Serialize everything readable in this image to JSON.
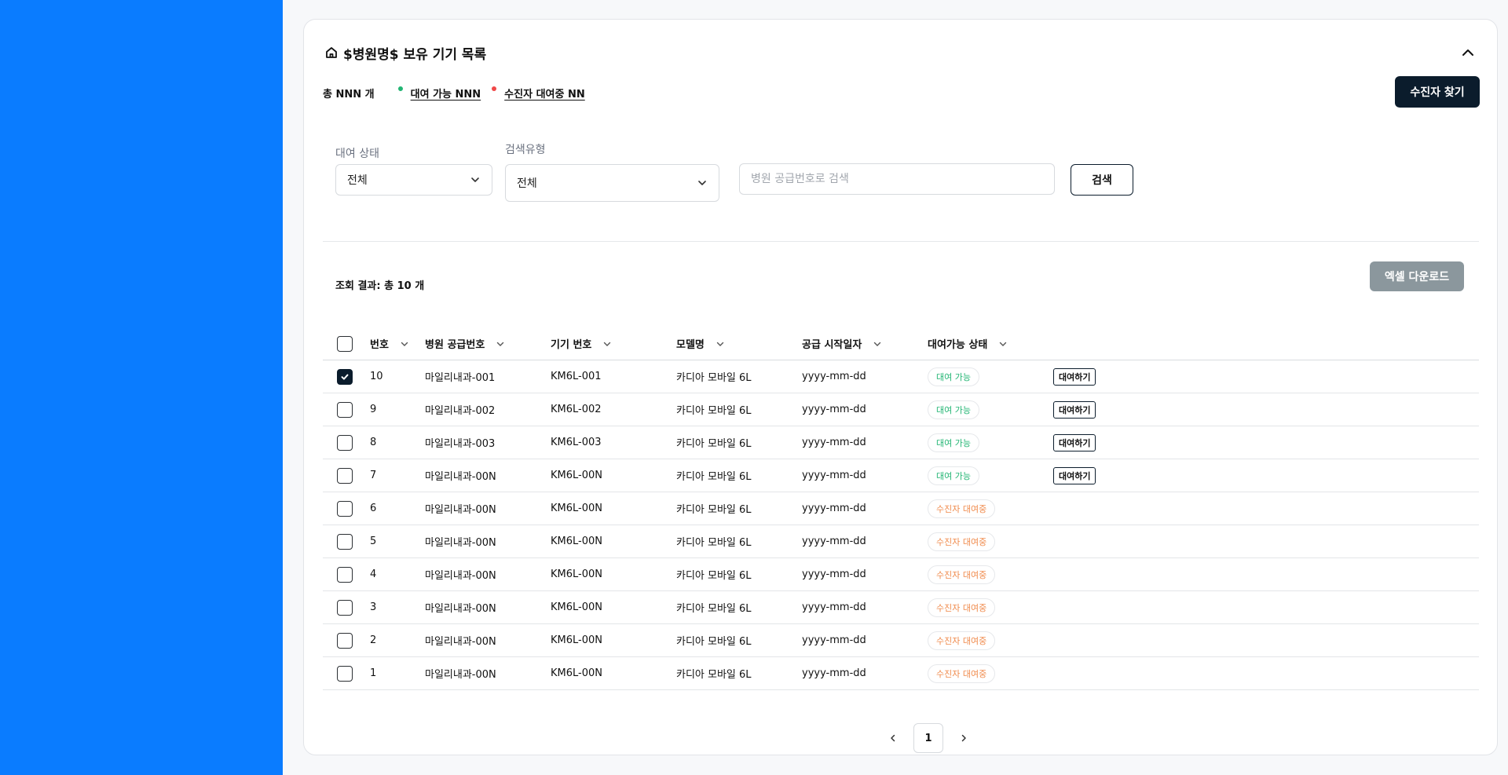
{
  "card": {
    "title": "$병원명$ 보유 기기 목록"
  },
  "summary": {
    "total": "총 NNN 개",
    "available_link": "대여 가능 NNN",
    "rented_link": "수진자 대여중 NN",
    "available_color": "#22b573",
    "rented_color": "#f04848"
  },
  "actions": {
    "find_patient": "수진자 찾기",
    "search": "검색",
    "excel": "엑셀 다운로드"
  },
  "filters": {
    "rental_status_label": "대여 상태",
    "rental_status_value": "전체",
    "search_type_label": "검색유형",
    "search_type_value": "전체",
    "search_placeholder": "병원 공급번호로 검색",
    "search_value": ""
  },
  "results": {
    "count_text": "조회 결과: 총 10 개"
  },
  "table": {
    "columns": [
      "번호",
      "병원 공급번호",
      "기기 번호",
      "모델명",
      "공급 시작일자",
      "대여가능 상태"
    ],
    "rows": [
      {
        "checked": true,
        "no": "10",
        "hospital_no": "마일리내과-001",
        "device_no": "KM6L-001",
        "model": "카디아 모바일 6L",
        "date": "yyyy-mm-dd",
        "status": "대여 가능",
        "status_type": "available",
        "action": "대여하기"
      },
      {
        "checked": false,
        "no": "9",
        "hospital_no": "마일리내과-002",
        "device_no": "KM6L-002",
        "model": "카디아 모바일 6L",
        "date": "yyyy-mm-dd",
        "status": "대여 가능",
        "status_type": "available",
        "action": "대여하기"
      },
      {
        "checked": false,
        "no": "8",
        "hospital_no": "마일리내과-003",
        "device_no": "KM6L-003",
        "model": "카디아 모바일 6L",
        "date": "yyyy-mm-dd",
        "status": "대여 가능",
        "status_type": "available",
        "action": "대여하기"
      },
      {
        "checked": false,
        "no": "7",
        "hospital_no": "마일리내과-00N",
        "device_no": "KM6L-00N",
        "model": "카디아 모바일 6L",
        "date": "yyyy-mm-dd",
        "status": "대여 가능",
        "status_type": "available",
        "action": "대여하기"
      },
      {
        "checked": false,
        "no": "6",
        "hospital_no": "마일리내과-00N",
        "device_no": "KM6L-00N",
        "model": "카디아 모바일 6L",
        "date": "yyyy-mm-dd",
        "status": "수진자 대여중",
        "status_type": "rented",
        "action": ""
      },
      {
        "checked": false,
        "no": "5",
        "hospital_no": "마일리내과-00N",
        "device_no": "KM6L-00N",
        "model": "카디아 모바일 6L",
        "date": "yyyy-mm-dd",
        "status": "수진자 대여중",
        "status_type": "rented",
        "action": ""
      },
      {
        "checked": false,
        "no": "4",
        "hospital_no": "마일리내과-00N",
        "device_no": "KM6L-00N",
        "model": "카디아 모바일 6L",
        "date": "yyyy-mm-dd",
        "status": "수진자 대여중",
        "status_type": "rented",
        "action": ""
      },
      {
        "checked": false,
        "no": "3",
        "hospital_no": "마일리내과-00N",
        "device_no": "KM6L-00N",
        "model": "카디아 모바일 6L",
        "date": "yyyy-mm-dd",
        "status": "수진자 대여중",
        "status_type": "rented",
        "action": ""
      },
      {
        "checked": false,
        "no": "2",
        "hospital_no": "마일리내과-00N",
        "device_no": "KM6L-00N",
        "model": "카디아 모바일 6L",
        "date": "yyyy-mm-dd",
        "status": "수진자 대여중",
        "status_type": "rented",
        "action": ""
      },
      {
        "checked": false,
        "no": "1",
        "hospital_no": "마일리내과-00N",
        "device_no": "KM6L-00N",
        "model": "카디아 모바일 6L",
        "date": "yyyy-mm-dd",
        "status": "수진자 대여중",
        "status_type": "rented",
        "action": ""
      }
    ]
  },
  "pagination": {
    "current_page": "1"
  },
  "colors": {
    "sidebar": "#0a7cff",
    "primary_dark": "#0b1c2c",
    "excel_button": "#8b979d"
  }
}
